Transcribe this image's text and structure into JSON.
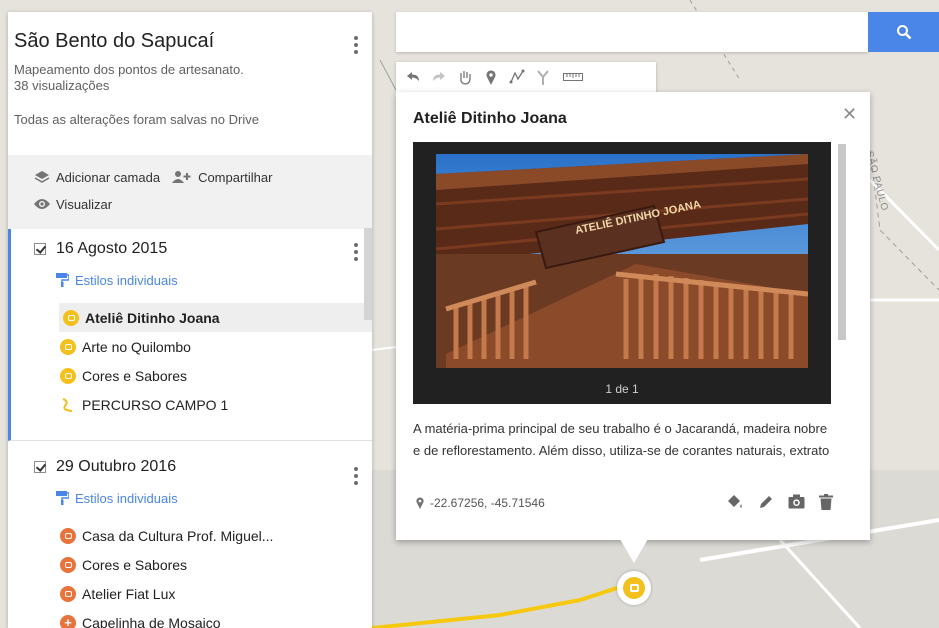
{
  "map": {
    "region_label": "SÃO PAULO"
  },
  "panel": {
    "title": "São Bento do Sapucaí",
    "description": "Mapeamento dos pontos de artesanato.",
    "views": "38 visualizações",
    "saved_status": "Todas as alterações foram salvas no Drive",
    "actions": {
      "add_layer": "Adicionar camada",
      "share": "Compartilhar",
      "preview": "Visualizar"
    },
    "layers": [
      {
        "name": "16 Agosto 2015",
        "styles_label": "Estilos individuais",
        "items": [
          {
            "label": "Ateliê Ditinho Joana",
            "color": "#f4c01b",
            "icon": "shopping-bag-icon"
          },
          {
            "label": "Arte no Quilombo",
            "color": "#f4c01b",
            "icon": "shopping-bag-icon"
          },
          {
            "label": "Cores e Sabores",
            "color": "#f4c01b",
            "icon": "shopping-bag-icon"
          },
          {
            "label": "PERCURSO CAMPO 1",
            "color": "#f4c01b",
            "icon": "route-icon"
          }
        ]
      },
      {
        "name": "29 Outubro 2016",
        "styles_label": "Estilos individuais",
        "items": [
          {
            "label": "Casa da Cultura Prof. Miguel...",
            "color": "#e8743b",
            "icon": "museum-icon"
          },
          {
            "label": "Cores e Sabores",
            "color": "#e8743b",
            "icon": "shopping-bag-icon"
          },
          {
            "label": "Atelier Fiat Lux",
            "color": "#e8743b",
            "icon": "shopping-bag-icon"
          },
          {
            "label": "Capelinha de Mosaico",
            "color": "#e8743b",
            "icon": "cross-icon"
          }
        ]
      }
    ]
  },
  "search": {
    "placeholder": "",
    "value": ""
  },
  "toolbar": [
    "undo-icon",
    "redo-icon",
    "hand-icon",
    "marker-icon",
    "draw-line-icon",
    "directions-icon",
    "ruler-icon"
  ],
  "info": {
    "title": "Ateliê Ditinho Joana",
    "photo_sign": "ATELIÊ DITINHO JOANA",
    "photo_counter": "1 de 1",
    "description": "A matéria-prima principal de seu trabalho é o Jacarandá, madeira nobre e de reflorestamento. Além disso, utiliza-se de corantes naturais, extrato",
    "coordinates": "-22.67256, -45.71546"
  },
  "colors": {
    "accent": "#4a86e8",
    "yellow_pin": "#f4c01b",
    "orange_pin": "#e8743b",
    "route": "#f6c90e"
  }
}
